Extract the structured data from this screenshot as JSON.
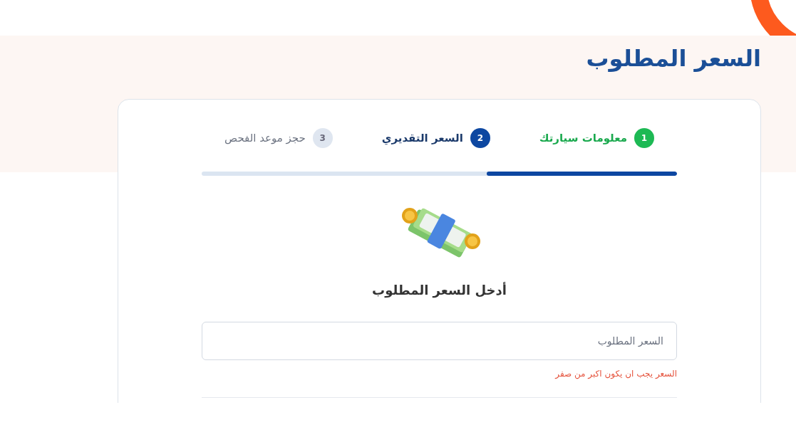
{
  "page_title": "السعر المطلوب",
  "steps": [
    {
      "number": "1",
      "label": "معلومات سيارتك",
      "kind": "done"
    },
    {
      "number": "2",
      "label": "السعر التقديري",
      "kind": "current"
    },
    {
      "number": "3",
      "label": "حجز موعد الفحص",
      "kind": "pending"
    }
  ],
  "progress": {
    "level": 0.4
  },
  "form": {
    "heading": "أدخل السعر المطلوب",
    "price_field": {
      "placeholder": "السعر المطلوب"
    },
    "error": "السعر يجب ان يكون اكبر من صفر"
  }
}
